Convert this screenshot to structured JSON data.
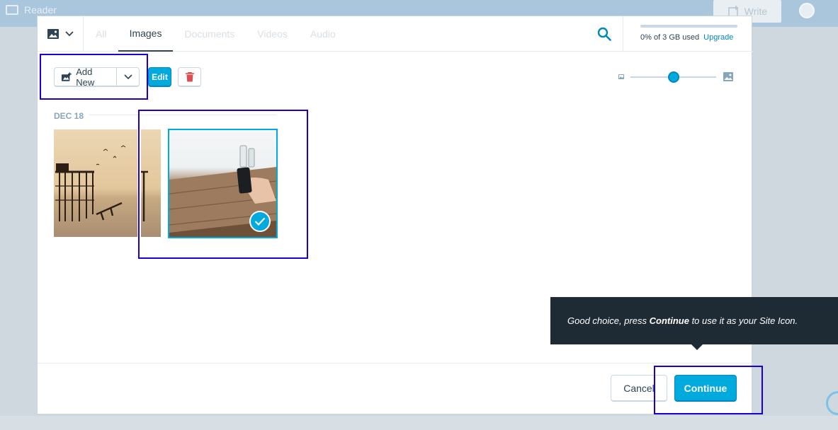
{
  "app": {
    "section_label": "Reader",
    "write_label": "Write"
  },
  "media_modal": {
    "tabs": [
      {
        "label": "All",
        "active": false
      },
      {
        "label": "Images",
        "active": true
      },
      {
        "label": "Documents",
        "active": false
      },
      {
        "label": "Videos",
        "active": false
      },
      {
        "label": "Audio",
        "active": false
      }
    ],
    "storage": {
      "used_fraction": 0.0,
      "text": "0% of 3 GB used",
      "upgrade_label": "Upgrade"
    },
    "toolbar": {
      "add_new_label": "Add New",
      "edit_label": "Edit"
    },
    "zoom": {
      "level_fraction": 0.5
    },
    "group_date": "DEC 18",
    "items": [
      {
        "name": "pier-sunset-photo",
        "selected": false
      },
      {
        "name": "pier-sunset-photo-partial",
        "selected": false
      },
      {
        "name": "hand-phone-table-photo",
        "selected": true
      }
    ],
    "footer": {
      "cancel_label": "Cancel",
      "continue_label": "Continue"
    }
  },
  "tooltip": {
    "prefix": "Good choice, press ",
    "emphasis": "Continue",
    "suffix": " to use it as your Site Icon."
  },
  "colors": {
    "accent": "#00aadc",
    "accent_dark": "#0087be",
    "text": "#2e4453",
    "tooltip_bg": "#1e2b35",
    "highlight": "#1a00d6"
  }
}
